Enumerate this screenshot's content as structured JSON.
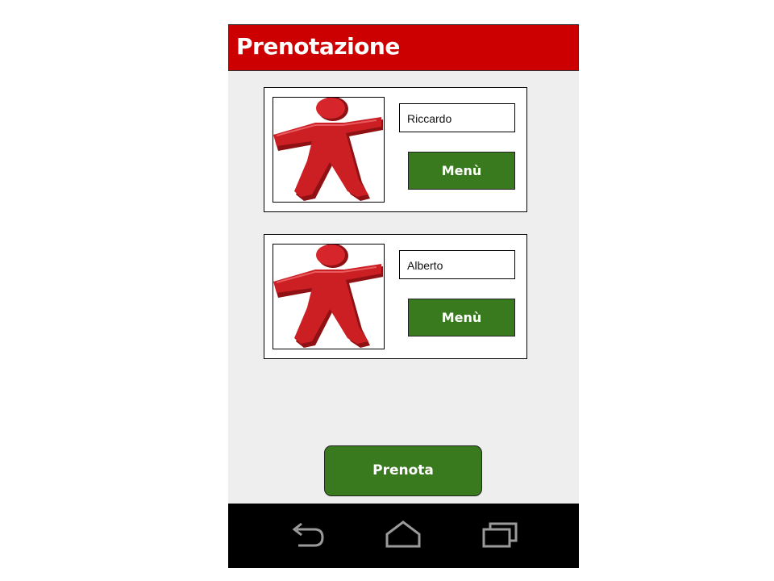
{
  "header": {
    "title": "Prenotazione"
  },
  "reservations": [
    {
      "name": "Riccardo",
      "menu_label": "Menù",
      "avatar_icon": "red-person-icon"
    },
    {
      "name": "Alberto",
      "menu_label": "Menù",
      "avatar_icon": "red-person-icon"
    }
  ],
  "actions": {
    "prenota_label": "Prenota"
  },
  "navbar": {
    "icons": [
      "back-icon",
      "home-icon",
      "recents-icon"
    ]
  },
  "colors": {
    "header_bg": "#cc0000",
    "button_green": "#3a7a1e",
    "screen_bg": "#eeeeee",
    "navbar_bg": "#000000",
    "avatar_red": "#cc1f24"
  }
}
